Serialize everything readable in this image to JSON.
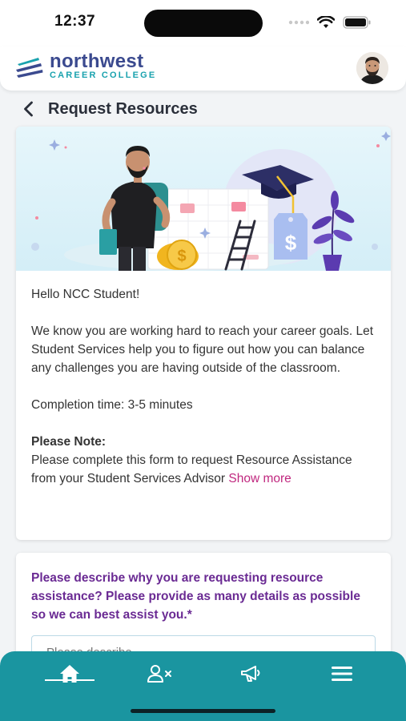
{
  "status_bar": {
    "time": "12:37"
  },
  "brand": {
    "name": "northwest",
    "subtitle": "CAREER COLLEGE"
  },
  "header": {
    "title": "Request Resources"
  },
  "intro": {
    "greeting": "Hello NCC Student!",
    "paragraph": "We know you are working hard to reach your career goals. Let Student Services help you to figure out how you can balance any challenges you are having outside of the classroom.",
    "completion": "Completion time: 3-5 minutes",
    "note_title": "Please Note:",
    "note_text": "Please complete this form to request Resource Assistance from your Student Services Advisor ",
    "show_more": "Show more"
  },
  "form": {
    "question": "Please describe why you are requesting resource assistance? Please provide as many details as possible so we can best assist you.*",
    "placeholder": "Please describe..."
  },
  "nav": {
    "items": [
      "home-icon",
      "user-remove-icon",
      "megaphone-icon",
      "menu-icon"
    ],
    "active": 0
  },
  "colors": {
    "brand_navy": "#3b4a8f",
    "brand_teal": "#19a2ae",
    "nav_bg": "#1a95a0",
    "question_purple": "#6a2a93",
    "link_magenta": "#c0287f"
  }
}
